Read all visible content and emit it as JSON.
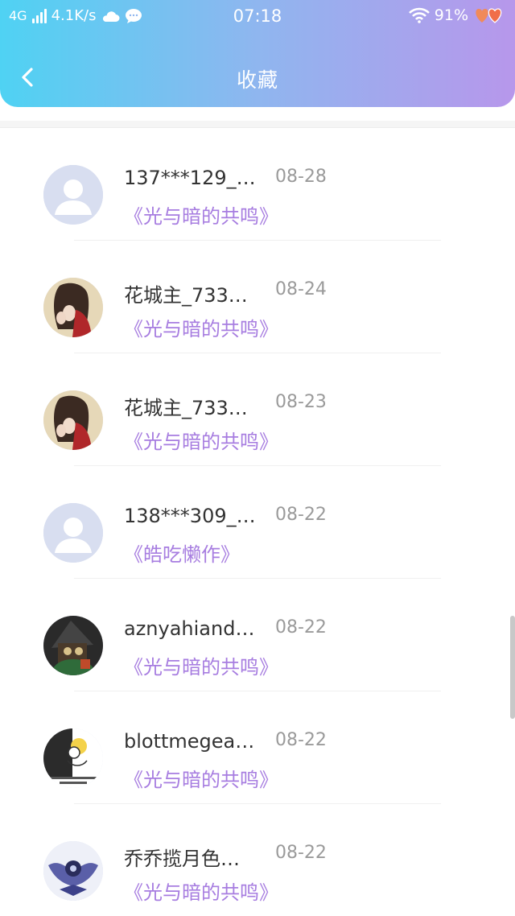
{
  "status_bar": {
    "network": "4G",
    "speed": "4.1K/s",
    "time": "07:18",
    "battery": "91%",
    "icons": [
      "signal-icon",
      "cloud-icon",
      "chat-bubble-icon",
      "wifi-icon",
      "hearts-icon"
    ]
  },
  "header": {
    "title": "收藏",
    "back_icon": "chevron-left-icon"
  },
  "colors": {
    "header_gradient_start": "#4fd2f3",
    "header_gradient_end": "#b797eb",
    "book_title": "#a77de0",
    "date": "#9a9a9a",
    "name": "#333333"
  },
  "favorites": [
    {
      "name": "137***129_…",
      "date": "08-28",
      "book": "《光与暗的共鸣》",
      "avatar": "default"
    },
    {
      "name": "花城主_733…",
      "date": "08-24",
      "book": "《光与暗的共鸣》",
      "avatar": "photo-brown"
    },
    {
      "name": "花城主_733…",
      "date": "08-23",
      "book": "《光与暗的共鸣》",
      "avatar": "photo-brown"
    },
    {
      "name": "138***309_…",
      "date": "08-22",
      "book": "《皓吃懒作》",
      "avatar": "default"
    },
    {
      "name": "aznyahiand…",
      "date": "08-22",
      "book": "《光与暗的共鸣》",
      "avatar": "photo-dark"
    },
    {
      "name": "blottmegea…",
      "date": "08-22",
      "book": "《光与暗的共鸣》",
      "avatar": "photo-sketch"
    },
    {
      "name": "乔乔揽月色…",
      "date": "08-22",
      "book": "《光与暗的共鸣》",
      "avatar": "photo-blue"
    }
  ]
}
